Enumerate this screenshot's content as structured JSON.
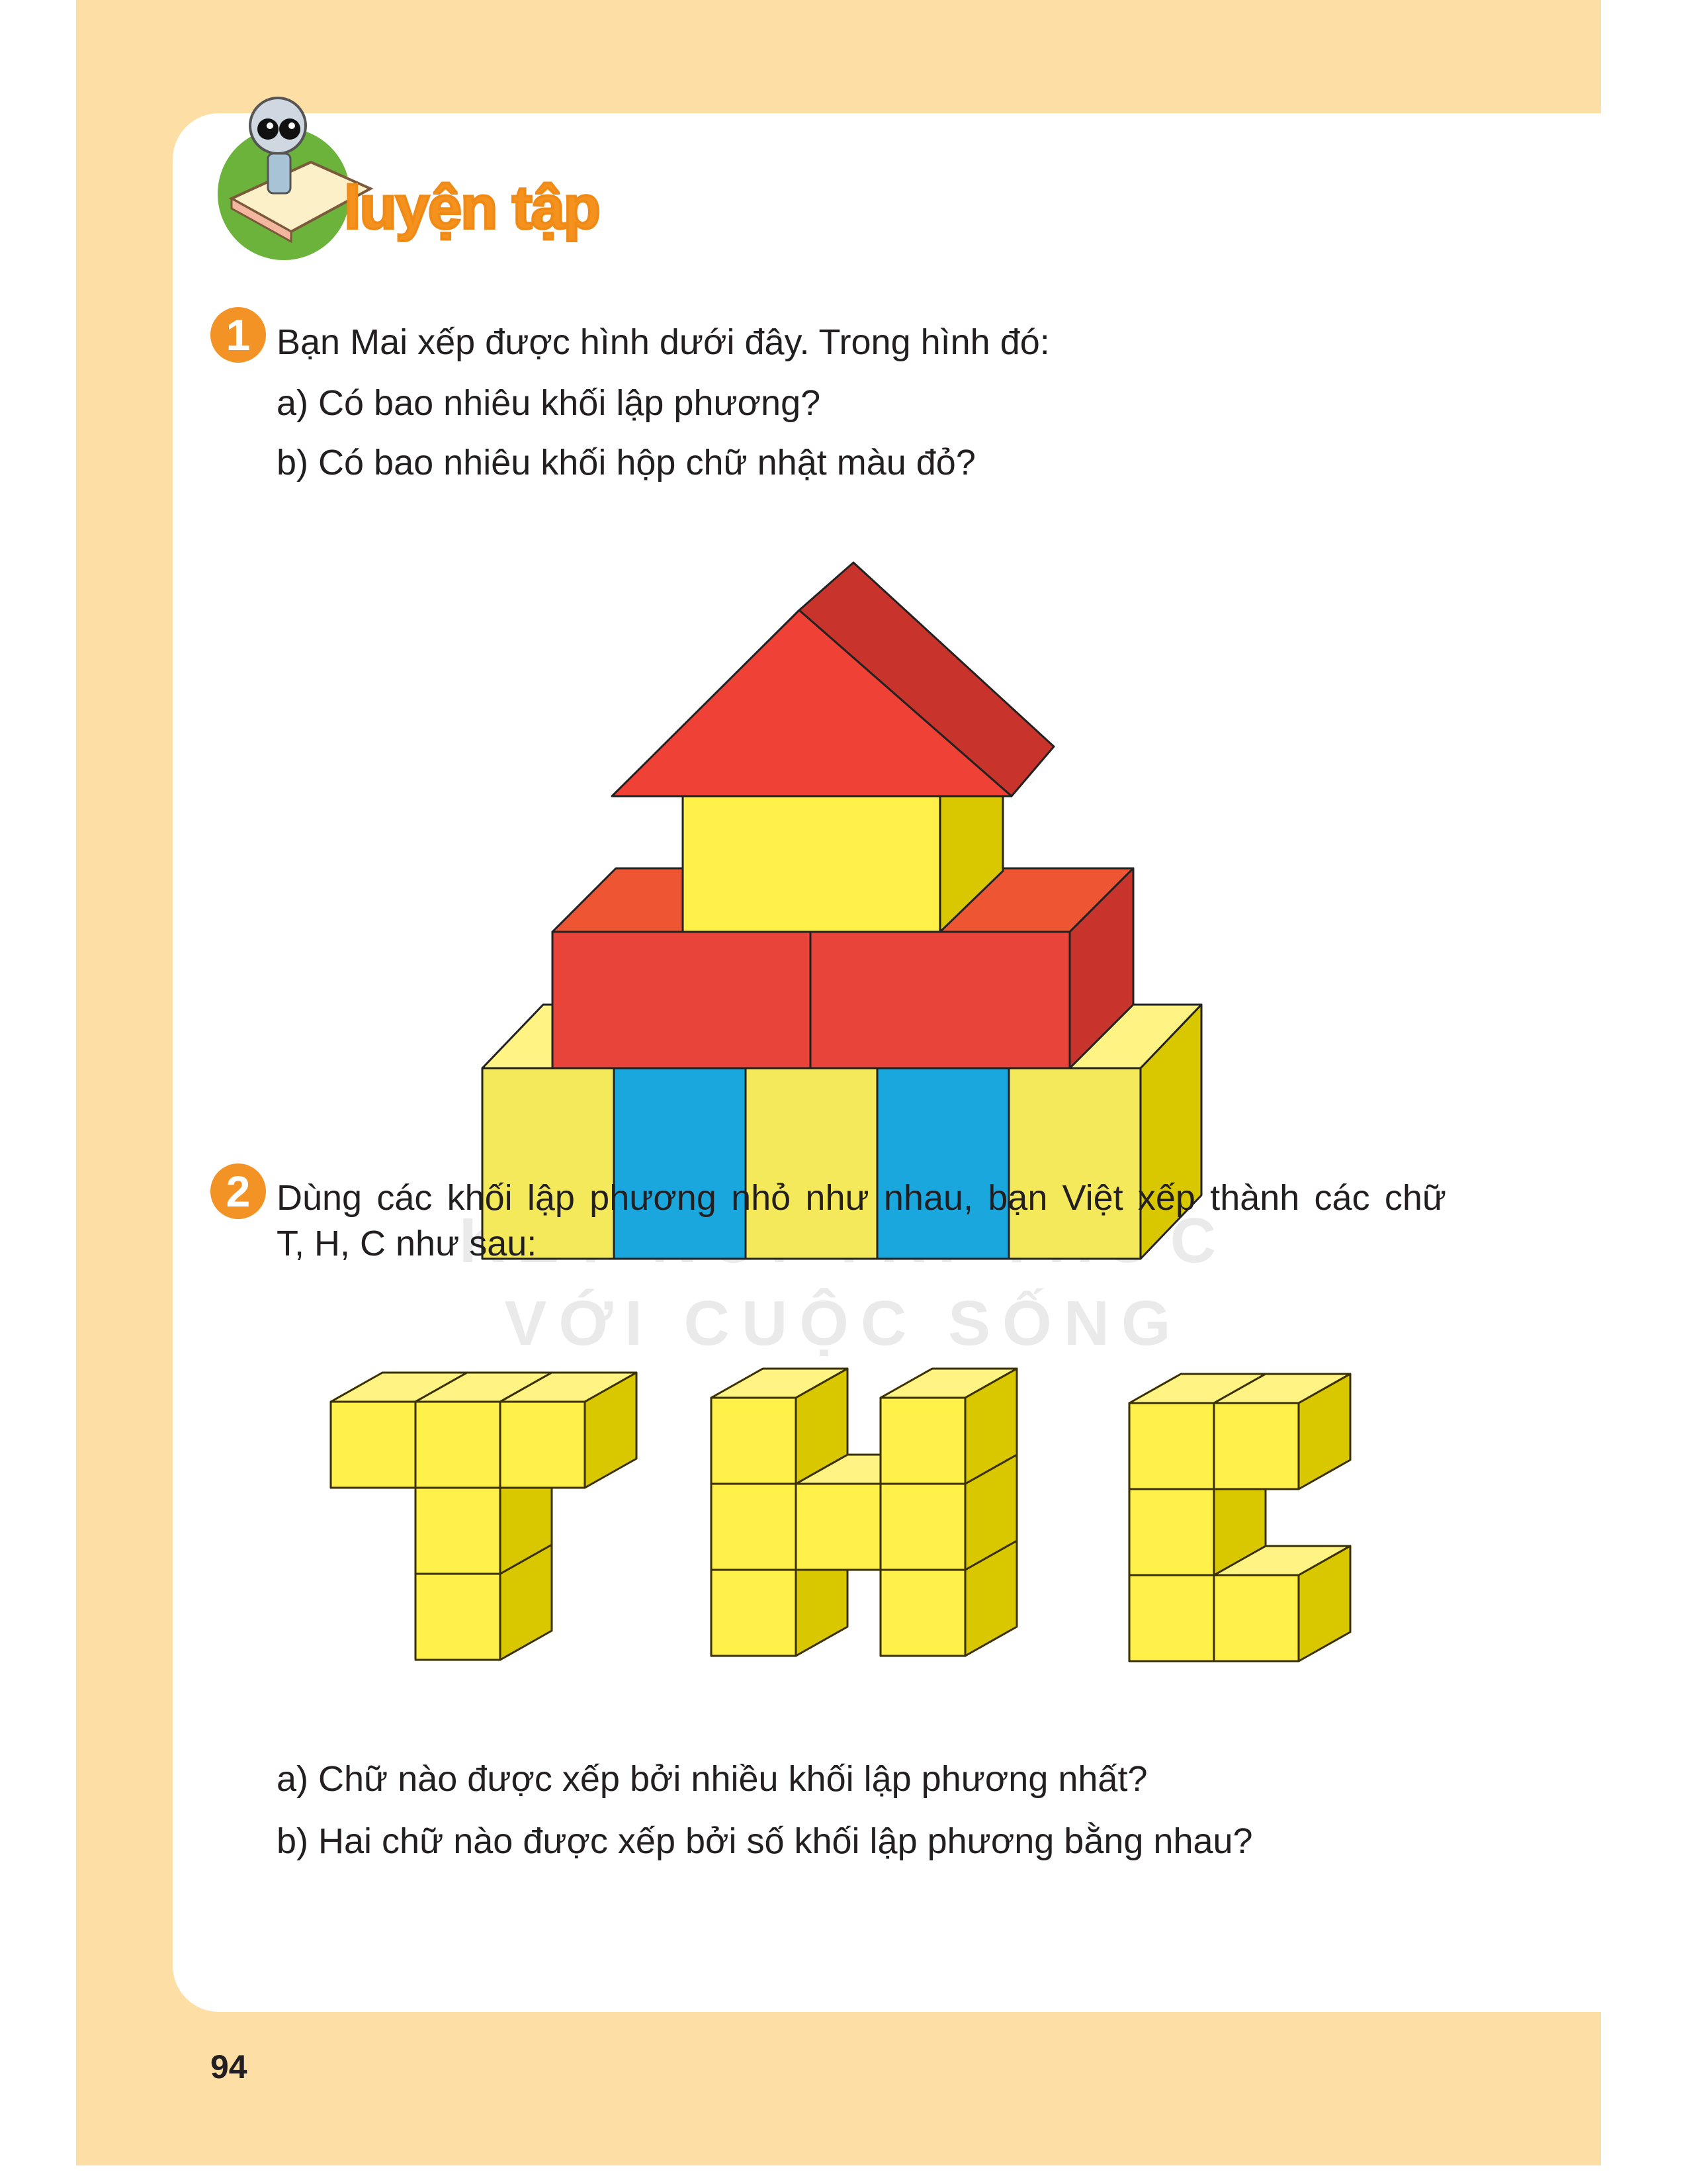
{
  "header": {
    "title": "luyện tập"
  },
  "exercise1": {
    "number": "1",
    "prompt": "Bạn Mai xếp được hình dưới đây. Trong hình đó:",
    "items": [
      "a) Có bao nhiêu khối lập phương?",
      "b) Có bao nhiêu khối hộp chữ nhật màu đỏ?"
    ]
  },
  "exercise2": {
    "number": "2",
    "prompt_line1": "Dùng các khối lập phương nhỏ như nhau, bạn Việt xếp thành các chữ",
    "prompt_line2": "T, H, C như sau:",
    "items": [
      "a) Chữ nào được xếp bởi nhiều khối lập phương nhất?",
      "b) Hai chữ nào được xếp bởi số khối lập phương bằng nhau?"
    ]
  },
  "watermark": {
    "line1": "KẾT NỐI TRI THỨC",
    "line2": "VỚI CUỘC SỐNG"
  },
  "page_number": "94",
  "colors": {
    "background": "#FDDFA6",
    "accent": "#F39325",
    "yellow": "#F7EC4F",
    "blue": "#1AA7DD",
    "red": "#E8443A"
  }
}
